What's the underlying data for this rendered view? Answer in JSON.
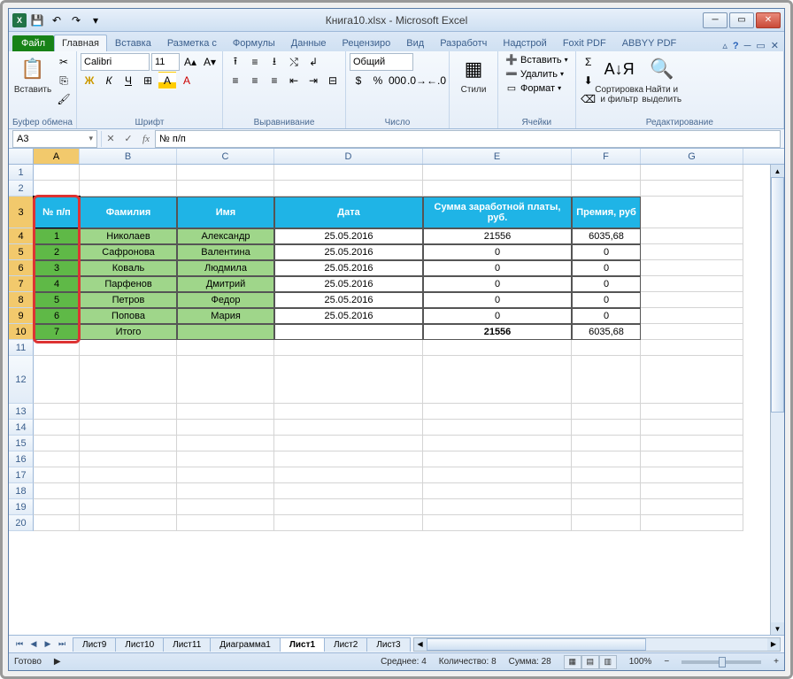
{
  "window": {
    "title": "Книга10.xlsx - Microsoft Excel"
  },
  "qat": {
    "save": "💾",
    "undo": "↶",
    "redo": "↷"
  },
  "tabs": {
    "file": "Файл",
    "home": "Главная",
    "insert": "Вставка",
    "layout": "Разметка с",
    "formulas": "Формулы",
    "data": "Данные",
    "review": "Рецензиро",
    "view": "Вид",
    "developer": "Разработч",
    "addins": "Надстрой",
    "foxit": "Foxit PDF",
    "abbyy": "ABBYY PDF"
  },
  "ribbon": {
    "clipboard": {
      "paste": "Вставить",
      "label": "Буфер обмена"
    },
    "font": {
      "name": "Calibri",
      "size": "11",
      "label": "Шрифт"
    },
    "alignment": {
      "label": "Выравнивание"
    },
    "number": {
      "format": "Общий",
      "label": "Число"
    },
    "styles": {
      "styles_btn": "Стили"
    },
    "cells": {
      "insert": "Вставить",
      "delete": "Удалить",
      "format": "Формат",
      "label": "Ячейки"
    },
    "editing": {
      "sort": "Сортировка\nи фильтр",
      "find": "Найти и\nвыделить",
      "label": "Редактирование"
    }
  },
  "formula_bar": {
    "name_box": "A3",
    "formula": "№ п/п"
  },
  "columns": [
    "A",
    "B",
    "C",
    "D",
    "E",
    "F",
    "G"
  ],
  "grid": {
    "header": {
      "no": "№ п/п",
      "surname": "Фамилия",
      "name": "Имя",
      "date": "Дата",
      "salary": "Сумма заработной платы, руб.",
      "bonus": "Премия, руб"
    },
    "rows": [
      {
        "no": "1",
        "surname": "Николаев",
        "name": "Александр",
        "date": "25.05.2016",
        "salary": "21556",
        "bonus": "6035,68"
      },
      {
        "no": "2",
        "surname": "Сафронова",
        "name": "Валентина",
        "date": "25.05.2016",
        "salary": "0",
        "bonus": "0"
      },
      {
        "no": "3",
        "surname": "Коваль",
        "name": "Людмила",
        "date": "25.05.2016",
        "salary": "0",
        "bonus": "0"
      },
      {
        "no": "4",
        "surname": "Парфенов",
        "name": "Дмитрий",
        "date": "25.05.2016",
        "salary": "0",
        "bonus": "0"
      },
      {
        "no": "5",
        "surname": "Петров",
        "name": "Федор",
        "date": "25.05.2016",
        "salary": "0",
        "bonus": "0"
      },
      {
        "no": "6",
        "surname": "Попова",
        "name": "Мария",
        "date": "25.05.2016",
        "salary": "0",
        "bonus": "0"
      },
      {
        "no": "7",
        "surname": "Итого",
        "name": "",
        "date": "",
        "salary": "21556",
        "bonus": "6035,68"
      }
    ]
  },
  "sheets": {
    "s9": "Лист9",
    "s10": "Лист10",
    "s11": "Лист11",
    "chart": "Диаграмма1",
    "s1": "Лист1",
    "s2": "Лист2",
    "s3": "Лист3"
  },
  "status": {
    "ready": "Готово",
    "avg_lbl": "Среднее:",
    "avg_val": "4",
    "cnt_lbl": "Количество:",
    "cnt_val": "8",
    "sum_lbl": "Сумма:",
    "sum_val": "28",
    "zoom": "100%"
  }
}
